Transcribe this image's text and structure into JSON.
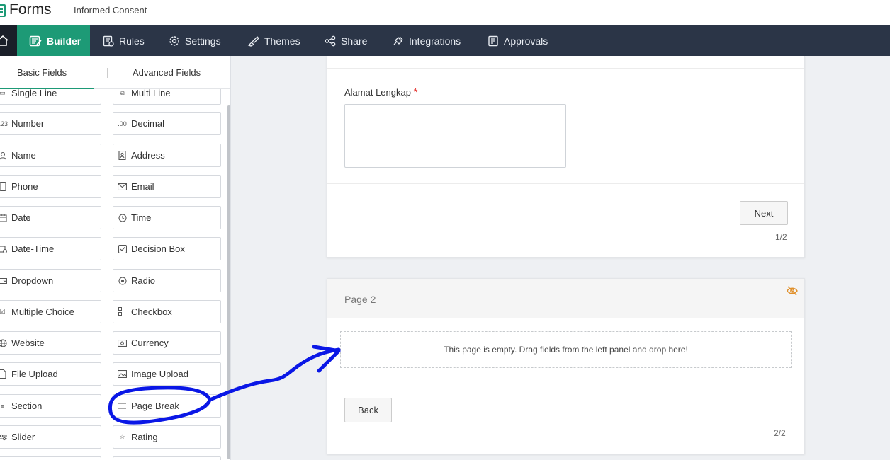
{
  "app": {
    "title": "Forms",
    "form_name": "Informed Consent"
  },
  "nav": {
    "tabs": [
      {
        "label": "Builder",
        "icon": "builder-icon",
        "active": true
      },
      {
        "label": "Rules",
        "icon": "rules-icon"
      },
      {
        "label": "Settings",
        "icon": "gear-icon"
      },
      {
        "label": "Themes",
        "icon": "brush-icon"
      },
      {
        "label": "Share",
        "icon": "share-icon"
      },
      {
        "label": "Integrations",
        "icon": "plug-icon"
      },
      {
        "label": "Approvals",
        "icon": "approvals-icon"
      }
    ]
  },
  "sidebar": {
    "tabs": [
      "Basic Fields",
      "Advanced Fields"
    ],
    "fields_left": [
      "Single Line",
      "Number",
      "Name",
      "Phone",
      "Date",
      "Date-Time",
      "Dropdown",
      "Multiple Choice",
      "Website",
      "File Upload",
      "Section",
      "Slider"
    ],
    "fields_right": [
      "Multi Line",
      "Decimal",
      "Address",
      "Email",
      "Time",
      "Decision Box",
      "Radio",
      "Checkbox",
      "Currency",
      "Image Upload",
      "Page Break",
      "Rating"
    ]
  },
  "page1": {
    "field_label": "Alamat Lengkap",
    "required_mark": "*",
    "next_label": "Next",
    "pager": "1/2"
  },
  "page2": {
    "title": "Page 2",
    "empty_message": "This page is empty. Drag fields from the left panel and drop here!",
    "back_label": "Back",
    "pager": "2/2"
  },
  "colors": {
    "accent": "#1d9a76",
    "nav_bg": "#2b3547",
    "annotation": "#0a17e6",
    "required": "#e53935",
    "hidden_icon": "#e0902b"
  }
}
